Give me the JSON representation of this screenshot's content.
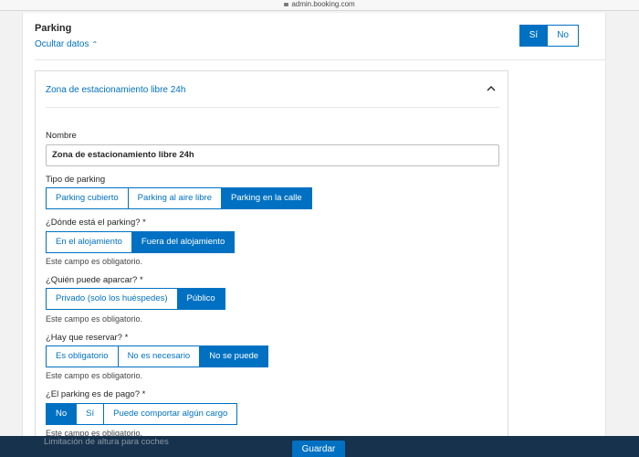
{
  "browser": {
    "url": "admin.booking.com"
  },
  "section": {
    "title": "Parking",
    "hide_link": "Ocultar datos",
    "toggle": {
      "yes": "Sí",
      "no": "No",
      "selected": "yes"
    }
  },
  "card": {
    "title": "Zona de estacionamiento libre 24h",
    "name": {
      "label": "Nombre",
      "value": "Zona de estacionamiento libre 24h"
    },
    "parking_type": {
      "label": "Tipo de parking",
      "options": [
        "Parking cubierto",
        "Parking al aire libre",
        "Parking en la calle"
      ],
      "selected": "Parking en la calle"
    },
    "location": {
      "label": "¿Dónde está el parking? *",
      "options": [
        "En el alojamiento",
        "Fuera del alojamiento"
      ],
      "selected": "Fuera del alojamiento",
      "hint": "Este campo es obligatorio."
    },
    "who_can_park": {
      "label": "¿Quién puede aparcar? *",
      "options": [
        "Privado (solo los huéspedes)",
        "Público"
      ],
      "selected": "Público",
      "hint": "Este campo es obligatorio."
    },
    "reservation": {
      "label": "¿Hay que reservar? *",
      "options": [
        "Es obligatorio",
        "No es necesario",
        "No se puede"
      ],
      "selected": "No se puede",
      "hint": "Este campo es obligatorio."
    },
    "paid": {
      "label": "¿El parking es de pago? *",
      "options": [
        "No",
        "Sí",
        "Puede comportar algún cargo"
      ],
      "selected": "No",
      "hint": "Este campo es obligatorio."
    },
    "height_limit": {
      "label": "Limitación de altura para coches"
    }
  },
  "footer": {
    "save_label": "Guardar"
  }
}
